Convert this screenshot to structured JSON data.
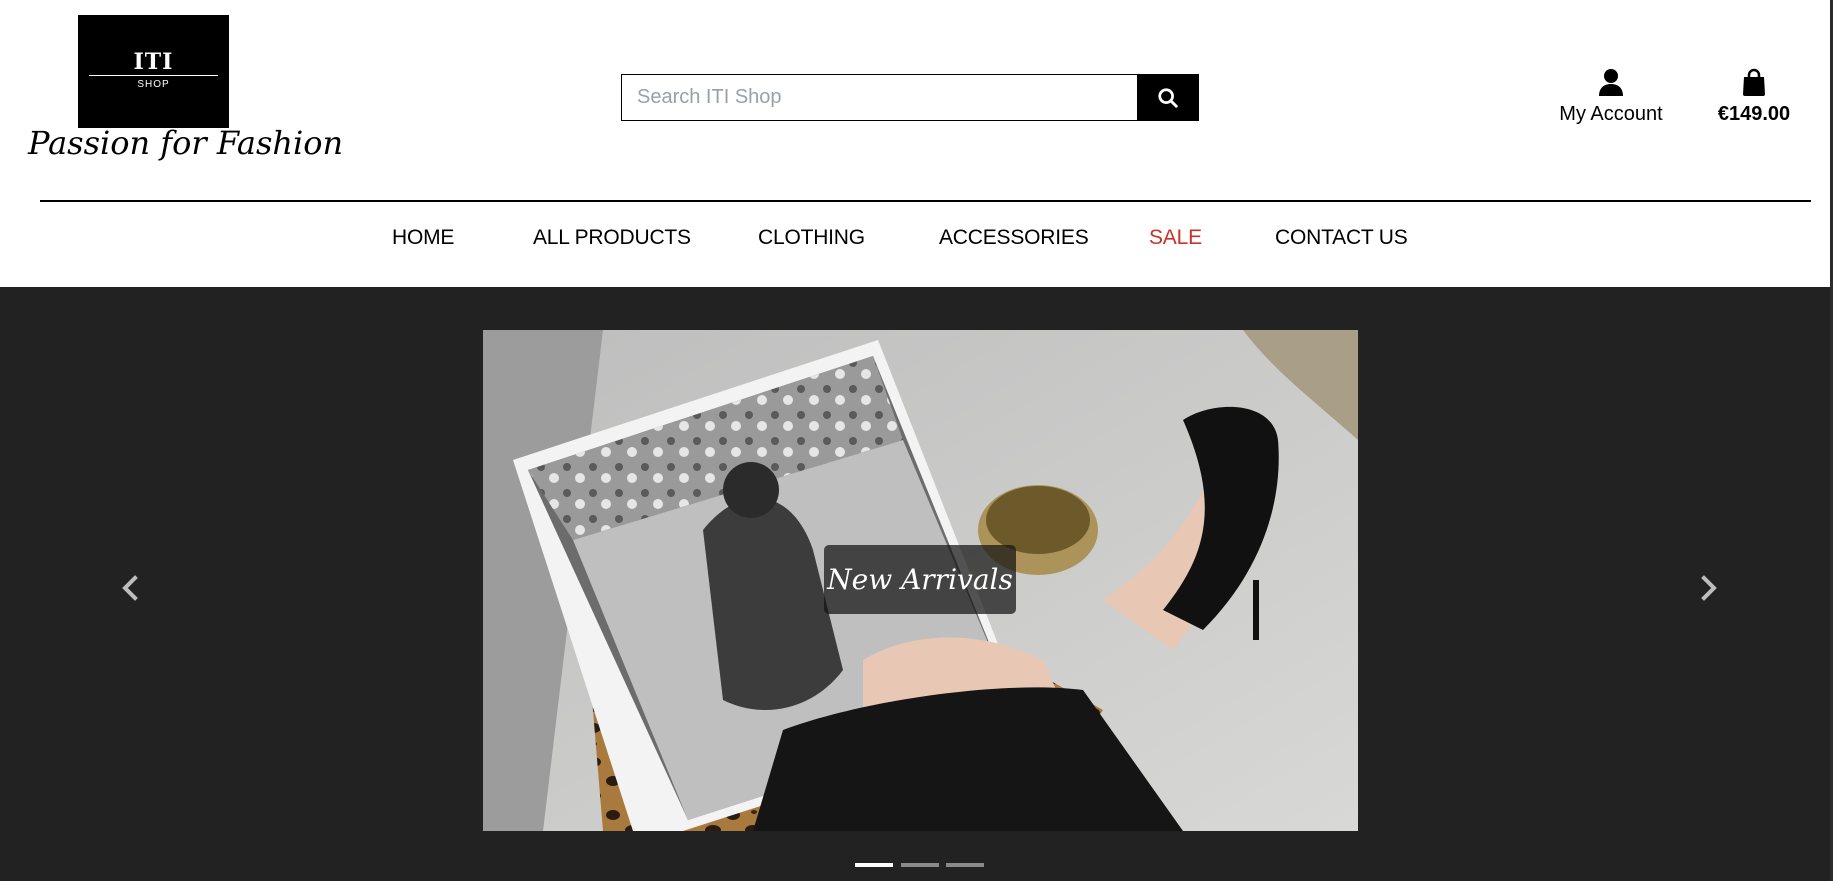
{
  "brand": {
    "logo_main": "ITI",
    "logo_sub": "SHOP",
    "tagline": "Passion for Fashion"
  },
  "search": {
    "placeholder": "Search ITI Shop",
    "value": ""
  },
  "header": {
    "account_label": "My Account",
    "bag_total": "€149.00"
  },
  "nav": {
    "items": [
      {
        "label": "HOME"
      },
      {
        "label": "ALL PRODUCTS"
      },
      {
        "label": "CLOTHING"
      },
      {
        "label": "ACCESSORIES"
      },
      {
        "label": "SALE"
      },
      {
        "label": "CONTACT US"
      }
    ]
  },
  "carousel": {
    "caption": "New Arrivals",
    "slide_count": 3,
    "active_index": 0
  },
  "colors": {
    "sale": "#c8322a",
    "carousel_bg": "#222222",
    "header_bg": "#ffffff"
  },
  "icons": {
    "search": "search-icon",
    "account": "user-icon",
    "bag": "shopping-bag-icon",
    "prev": "chevron-left-icon",
    "next": "chevron-right-icon"
  }
}
